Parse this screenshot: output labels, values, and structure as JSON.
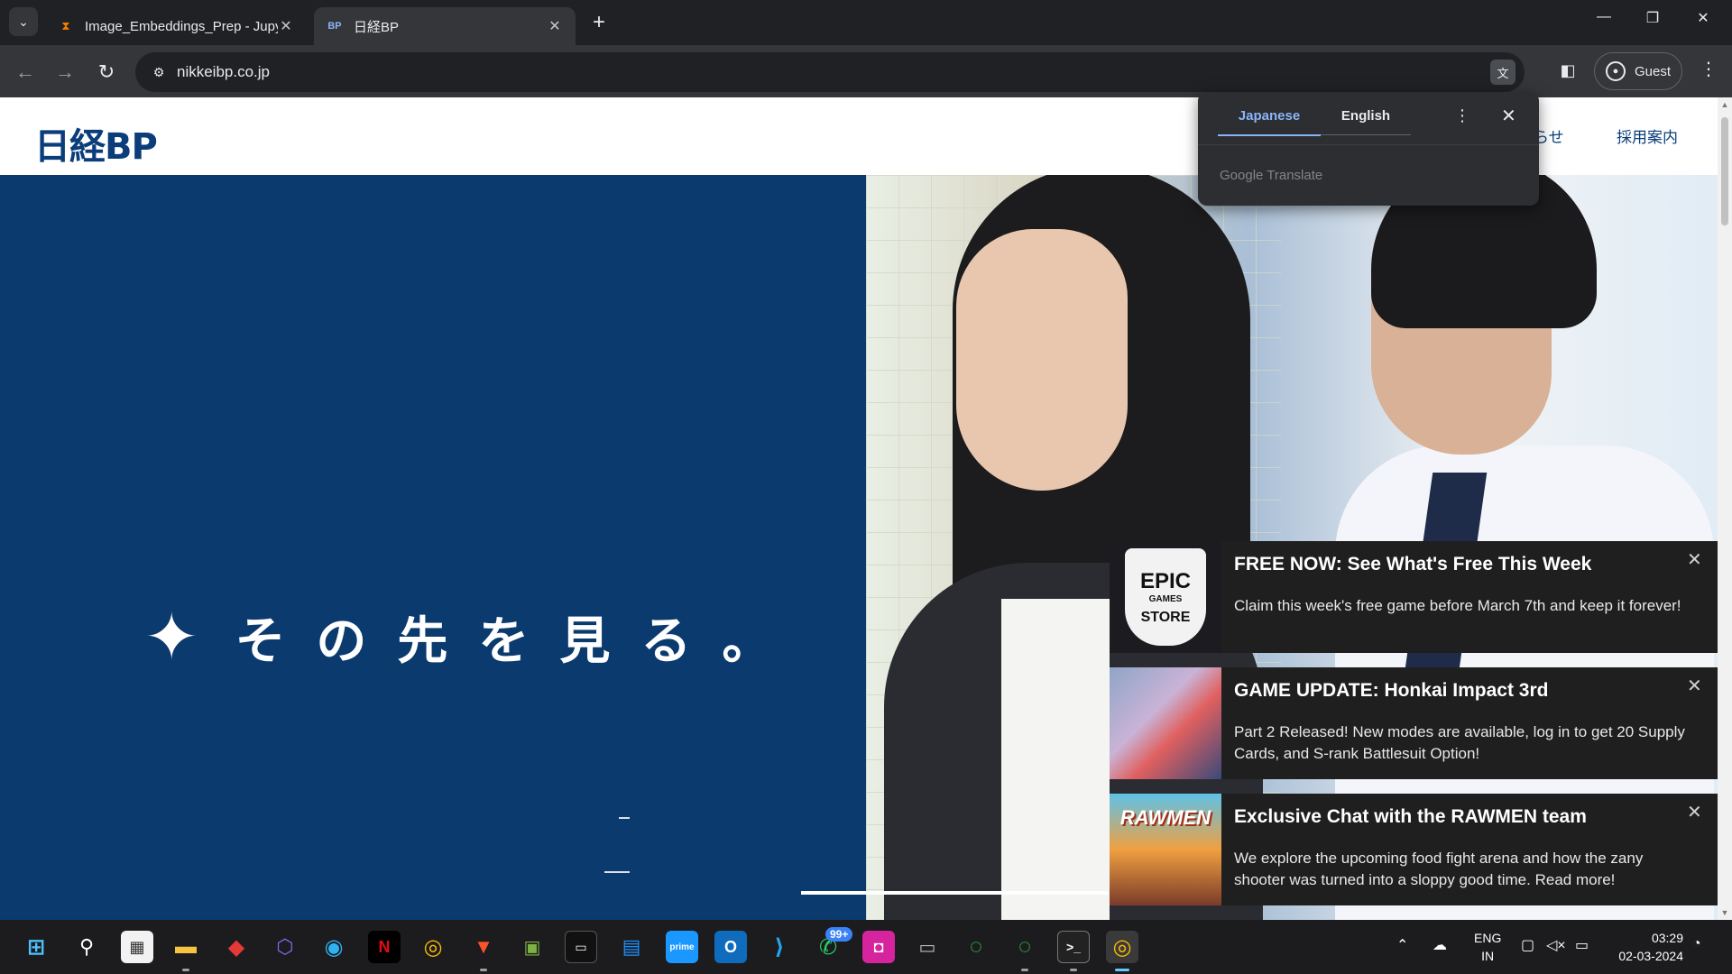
{
  "browser": {
    "tabs": [
      {
        "title": "Image_Embeddings_Prep - Jupy",
        "active": false,
        "favicon": "hourglass-icon"
      },
      {
        "title": "日経BP",
        "active": true,
        "favicon": "nikkeibp-favicon"
      }
    ],
    "new_tab_label": "+",
    "url": "nikkeibp.co.jp",
    "profile_label": "Guest"
  },
  "translate_popup": {
    "tab_japanese": "Japanese",
    "tab_english": "English",
    "brand": "Google Translate"
  },
  "site": {
    "logo": "日経BP",
    "nav": [
      "らせ",
      "採用案内"
    ],
    "hero_tagline": "その先を見る。",
    "hero_sparkle": "✦"
  },
  "notifications": [
    {
      "title": "FREE NOW: See What's Free This Week",
      "body": "Claim this week's free game before March 7th and keep it forever!",
      "thumb": "epic-games-store",
      "thumb_text": [
        "EPIC",
        "GAMES",
        "STORE"
      ]
    },
    {
      "title": "GAME UPDATE: Honkai Impact 3rd",
      "body": "Part 2 Released! New modes are available, log in to get 20 Supply Cards, and S-rank Battlesuit Option!",
      "thumb": "honkai-impact"
    },
    {
      "title": "Exclusive Chat with the RAWMEN team",
      "body": "We explore the upcoming food fight arena and how the zany shooter was turned into a sloppy good time. Read more!",
      "thumb": "rawmen",
      "thumb_text": "RAWMEN"
    }
  ],
  "taskbar": {
    "whatsapp_badge": "99+",
    "language": "ENG",
    "region": "IN",
    "time": "03:29",
    "date": "02-03-2024"
  }
}
